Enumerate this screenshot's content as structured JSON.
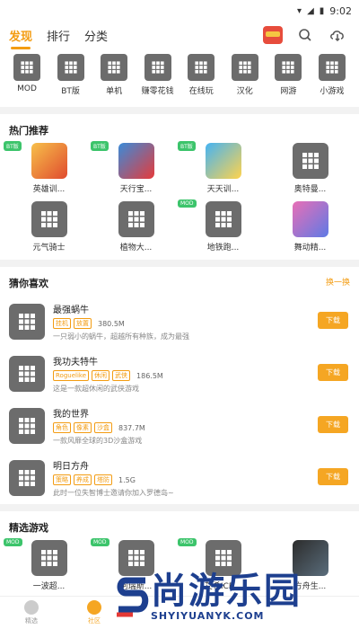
{
  "status": {
    "time": "9:02"
  },
  "header": {
    "tabs": [
      {
        "label": "发现",
        "active": true
      },
      {
        "label": "排行",
        "active": false
      },
      {
        "label": "分类",
        "active": false
      }
    ]
  },
  "categories": [
    "MOD",
    "BT版",
    "单机",
    "赚零花钱",
    "在线玩",
    "汉化",
    "网游",
    "小游戏"
  ],
  "hot": {
    "title": "热门推荐",
    "items": [
      {
        "name": "英雄训...",
        "badge": "BT版",
        "style": "color1"
      },
      {
        "name": "天行宝...",
        "badge": "BT版",
        "style": "color2"
      },
      {
        "name": "天天训...",
        "badge": "BT版",
        "style": "color3"
      },
      {
        "name": "奥特曼...",
        "badge": "",
        "style": "cube"
      },
      {
        "name": "元气骑士",
        "badge": "",
        "style": "cube"
      },
      {
        "name": "植物大...",
        "badge": "",
        "style": "cube"
      },
      {
        "name": "地铁跑...",
        "badge": "MOD",
        "style": "cube"
      },
      {
        "name": "舞动精...",
        "badge": "",
        "style": "color4"
      }
    ]
  },
  "guess": {
    "title": "猜你喜欢",
    "more": "换一换",
    "items": [
      {
        "name": "最强蜗牛",
        "tags": [
          "挂机",
          "放置"
        ],
        "size": "380.5M",
        "desc": "一只弱小的蜗牛，超越所有种族，成为最强",
        "btn": "下载"
      },
      {
        "name": "我功夫特牛",
        "tags": [
          "Roguelike",
          "休闲",
          "武侠"
        ],
        "size": "186.5M",
        "desc": "这是一款超休闲的武侠游戏",
        "btn": "下载"
      },
      {
        "name": "我的世界",
        "tags": [
          "角色",
          "像素",
          "沙盒"
        ],
        "size": "837.7M",
        "desc": "一款风靡全球的3D沙盒游戏",
        "btn": "下载"
      },
      {
        "name": "明日方舟",
        "tags": [
          "策略",
          "养成",
          "塔防"
        ],
        "size": "1.5G",
        "desc": "此时一位失智博士邀请你加入罗德岛~",
        "btn": "下载"
      }
    ]
  },
  "select": {
    "title": "精选游戏",
    "items": [
      {
        "name": "一波超...",
        "badge": "MOD",
        "style": "cube"
      },
      {
        "name": "阿瑞斯...",
        "badge": "MOD",
        "style": "cube"
      },
      {
        "name": "艾希ICE...",
        "badge": "MOD",
        "style": "cube"
      },
      {
        "name": "方舟生...",
        "badge": "",
        "style": "color5"
      }
    ]
  },
  "bottomnav": [
    {
      "label": "精选",
      "active": false
    },
    {
      "label": "社区",
      "active": true
    }
  ],
  "watermark": {
    "cn": "尚游乐园",
    "en": "SHYIYUANYK.COM"
  }
}
